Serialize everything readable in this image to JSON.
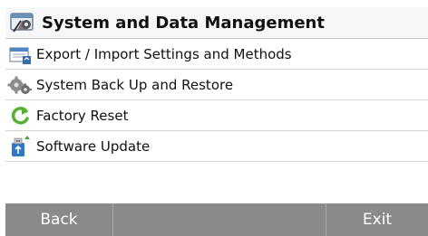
{
  "header": {
    "title": "System and Data Management",
    "icon": "tools-window-icon"
  },
  "menu": {
    "items": [
      {
        "label": "Export / Import  Settings and Methods",
        "icon": "export-import-icon"
      },
      {
        "label": "System Back Up and Restore",
        "icon": "gears-icon"
      },
      {
        "label": "Factory Reset",
        "icon": "reset-arrow-icon"
      },
      {
        "label": "Software Update",
        "icon": "usb-update-icon"
      }
    ]
  },
  "footer": {
    "back_label": "Back",
    "exit_label": "Exit"
  },
  "colors": {
    "footer_bg": "#8a8a8a",
    "reset_green": "#57b031",
    "update_blue": "#2f78c8"
  }
}
